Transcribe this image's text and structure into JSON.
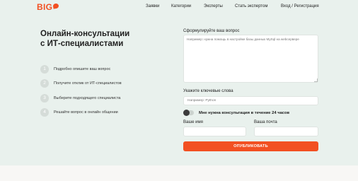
{
  "header": {
    "logo_text": "BIG",
    "nav": {
      "requests": "Заявки",
      "categories": "Категории",
      "experts": "Эксперты",
      "become_expert": "Стать экспертом",
      "login": "Вход / Регистрация"
    }
  },
  "hero": {
    "title_line1": "Онлайн-консультации",
    "title_line2": "с ИТ-специалистами",
    "steps": [
      {
        "num": "1",
        "text": "Подробно опишите ваш вопрос"
      },
      {
        "num": "2",
        "text": "Получите отклик от ИТ-специалистов"
      },
      {
        "num": "3",
        "text": "Выберите подходящего специалиста"
      },
      {
        "num": "4",
        "text": "Решайте вопрос в онлайн общении"
      }
    ]
  },
  "form": {
    "question_label": "Сформулируйте ваш вопрос",
    "question_placeholder": "Например: нужна помощь в настройке базы данных MySql на webсервере",
    "keywords_label": "Укажите ключевые слова",
    "keywords_placeholder": "Например: Python",
    "toggle_label": "Мне нужна консультация в течение 24 часов",
    "toggle_on": false,
    "name_label": "Ваше имя",
    "email_label": "Ваша почта",
    "name_value": "",
    "email_value": "",
    "submit_label": "ОПУБЛИКОВАТЬ"
  },
  "colors": {
    "accent": "#f25022",
    "background": "#e9f1ed"
  }
}
